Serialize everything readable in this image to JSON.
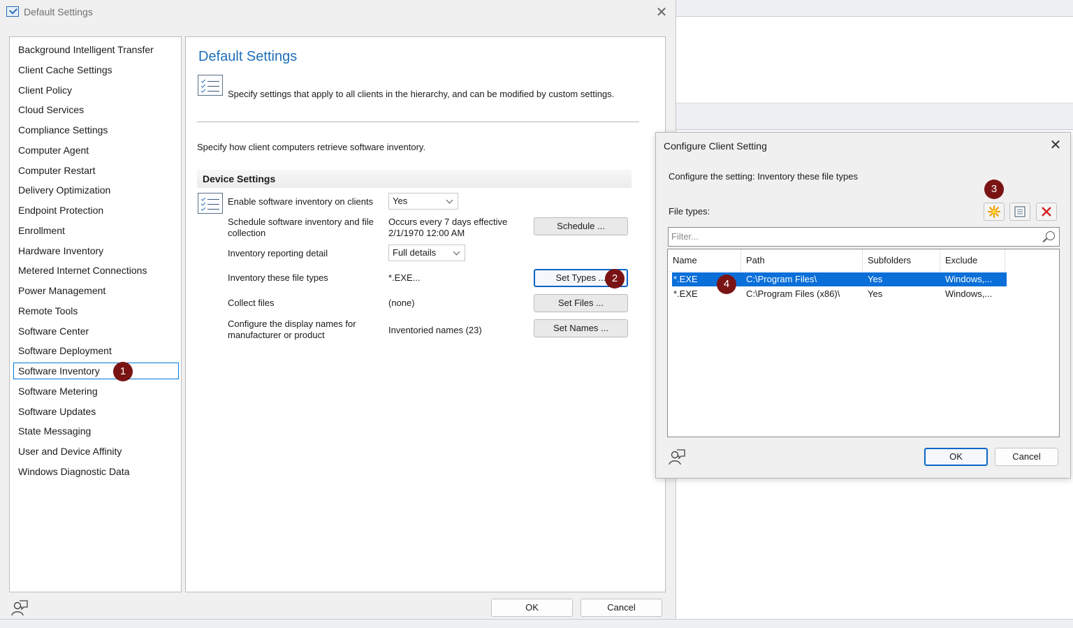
{
  "main_dialog": {
    "window_title": "Default Settings",
    "nav_items": [
      "Background Intelligent Transfer",
      "Client Cache Settings",
      "Client Policy",
      "Cloud Services",
      "Compliance Settings",
      "Computer Agent",
      "Computer Restart",
      "Delivery Optimization",
      "Endpoint Protection",
      "Enrollment",
      "Hardware Inventory",
      "Metered Internet Connections",
      "Power Management",
      "Remote Tools",
      "Software Center",
      "Software Deployment",
      "Software Inventory",
      "Software Metering",
      "Software Updates",
      "State Messaging",
      "User and Device Affinity",
      "Windows Diagnostic Data"
    ],
    "selected_nav": "Software Inventory",
    "heading": "Default Settings",
    "description": "Specify settings that apply to all clients in the hierarchy, and can be modified by custom settings.",
    "retrieve_text": "Specify how client computers retrieve software inventory.",
    "section_title": "Device Settings",
    "settings": {
      "enable_label": "Enable software inventory on clients",
      "enable_value": "Yes",
      "schedule_label_1": "Schedule software inventory and file",
      "schedule_label_2": "collection",
      "schedule_value_1": "Occurs every 7 days effective",
      "schedule_value_2": "2/1/1970 12:00 AM",
      "schedule_button": "Schedule ...",
      "detail_label": "Inventory reporting detail",
      "detail_value": "Full details",
      "filetypes_label": "Inventory these file types",
      "filetypes_value": "*.EXE...",
      "filetypes_button": "Set Types ...",
      "collect_label": "Collect files",
      "collect_value": "(none)",
      "collect_button": "Set Files ...",
      "names_label_1": "Configure the display names for",
      "names_label_2": "manufacturer or product",
      "names_value": "Inventoried names (23)",
      "names_button": "Set Names ..."
    },
    "ok_button": "OK",
    "cancel_button": "Cancel"
  },
  "config_dialog": {
    "title": "Configure Client Setting",
    "subtitle": "Configure the setting: Inventory these file types",
    "file_types_label": "File types:",
    "filter_placeholder": "Filter...",
    "columns": [
      "Name",
      "Path",
      "Subfolders",
      "Exclude"
    ],
    "rows": [
      {
        "name": "*.EXE",
        "path": "C:\\Program Files\\",
        "subfolders": "Yes",
        "exclude": "Windows,..."
      },
      {
        "name": "*.EXE",
        "path": "C:\\Program Files (x86)\\",
        "subfolders": "Yes",
        "exclude": "Windows,..."
      }
    ],
    "ok_button": "OK",
    "cancel_button": "Cancel"
  },
  "callouts": [
    "1",
    "2",
    "3",
    "4"
  ],
  "colors": {
    "heading_blue": "#1e6fb8",
    "selection_blue": "#0a6fd8",
    "callout_red": "#7a1414"
  },
  "icons": [
    "checklist-icon",
    "close-icon",
    "new-star-icon",
    "properties-icon",
    "delete-x-icon",
    "search-icon",
    "user-feedback-icon"
  ]
}
